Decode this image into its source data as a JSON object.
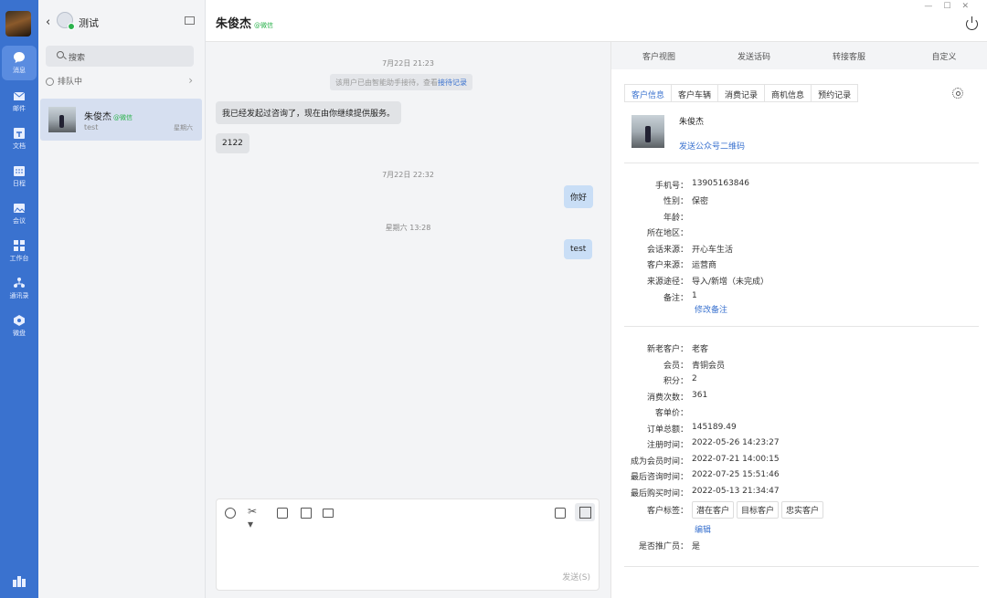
{
  "rail": {
    "items": [
      {
        "label": "消息",
        "icon": "chat-bubble-icon"
      },
      {
        "label": "邮件",
        "icon": "mail-icon"
      },
      {
        "label": "文档",
        "icon": "document-icon"
      },
      {
        "label": "日程",
        "icon": "calendar-icon"
      },
      {
        "label": "会议",
        "icon": "meeting-icon"
      },
      {
        "label": "工作台",
        "icon": "grid-icon"
      },
      {
        "label": "通讯录",
        "icon": "contacts-icon"
      },
      {
        "label": "微盘",
        "icon": "drive-icon"
      }
    ]
  },
  "sessions": {
    "title": "测试",
    "search_placeholder": "搜索",
    "queue_label": "排队中",
    "items": [
      {
        "name": "朱俊杰",
        "tag": "@微信",
        "last_msg": "test",
        "time": "星期六"
      }
    ]
  },
  "header": {
    "contact_name": "朱俊杰",
    "contact_tag": "@微信"
  },
  "chat": {
    "messages": [
      {
        "kind": "time",
        "text": "7月22日 21:23"
      },
      {
        "kind": "system",
        "text": "该用户已由智能助手接待，查看",
        "link": "接待记录"
      },
      {
        "kind": "in",
        "text": "我已经发起过咨询了，现在由你继续提供服务。"
      },
      {
        "kind": "in",
        "text": "2122"
      },
      {
        "kind": "time",
        "text": "7月22日 22:32"
      },
      {
        "kind": "out",
        "text": "你好"
      },
      {
        "kind": "time",
        "text": "星期六 13:28"
      },
      {
        "kind": "out",
        "text": "test"
      }
    ],
    "send_label": "发送(S)"
  },
  "right": {
    "tabs": [
      "客户视图",
      "发送话码",
      "转接客服",
      "自定义"
    ],
    "subtabs": [
      "客户信息",
      "客户车辆",
      "消费记录",
      "商机信息",
      "预约记录"
    ],
    "customer_name": "朱俊杰",
    "qr_link": "发送公众号二维码",
    "fields1": [
      {
        "k": "手机号：",
        "v": "13905163846"
      },
      {
        "k": "性别：",
        "v": "保密"
      },
      {
        "k": "年龄：",
        "v": ""
      },
      {
        "k": "所在地区：",
        "v": ""
      },
      {
        "k": "会话来源：",
        "v": "开心车生活"
      },
      {
        "k": "客户来源：",
        "v": "运营商"
      },
      {
        "k": "来源途径：",
        "v": "导入/新增（未完成）"
      },
      {
        "k": "备注：",
        "v": "1"
      }
    ],
    "edit_note": "修改备注",
    "fields2": [
      {
        "k": "新老客户：",
        "v": "老客"
      },
      {
        "k": "会员：",
        "v": "青铜会员"
      },
      {
        "k": "积分：",
        "v": "2"
      },
      {
        "k": "消费次数：",
        "v": "361"
      },
      {
        "k": "客单价：",
        "v": ""
      },
      {
        "k": "订单总额：",
        "v": "145189.49"
      },
      {
        "k": "注册时间：",
        "v": "2022-05-26 14:23:27"
      },
      {
        "k": "成为会员时间：",
        "v": "2022-07-21 14:00:15"
      },
      {
        "k": "最后咨询时间：",
        "v": "2022-07-25 15:51:46"
      },
      {
        "k": "最后购买时间：",
        "v": "2022-05-13 21:34:47"
      }
    ],
    "tags_label": "客户标签：",
    "tags": [
      "潜在客户",
      "目标客户",
      "忠实客户"
    ],
    "edit_tags": "编辑",
    "promoter_label": "是否推广员：",
    "promoter_value": "是"
  },
  "colors": {
    "rail": "#3a72cf",
    "accent": "#3a72cf",
    "wechat_green": "#2bb24c",
    "outgoing_bubble": "#c9def6"
  }
}
